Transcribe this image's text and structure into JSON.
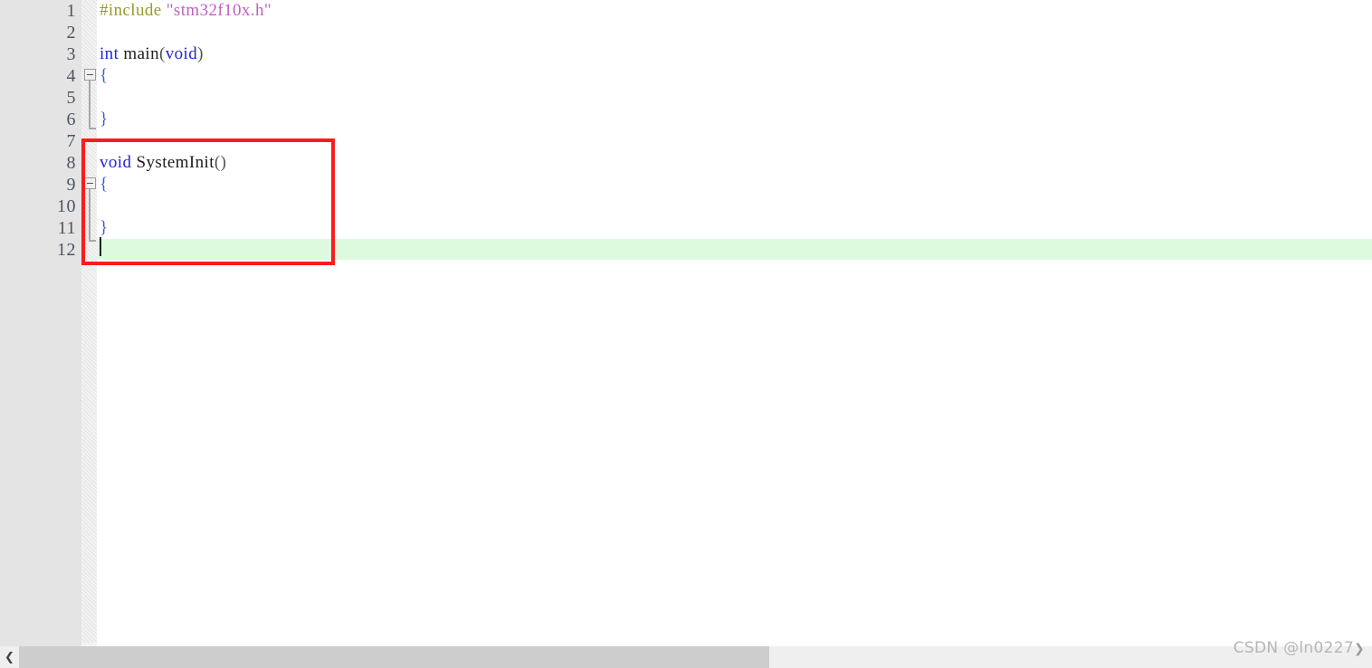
{
  "editor": {
    "language": "c",
    "line_height_px": 24,
    "colors": {
      "gutter_background": "#e4e4e4",
      "fold_strip_background": "#f3f3f3",
      "current_line_highlight": "#ddfade",
      "annotation_rectangle": "#fd1b1b",
      "preprocessor": "#9a9a24",
      "string": "#c060c0",
      "keyword": "#2424d8",
      "identifier": "#1c1c1c",
      "line_number": "#4d5663",
      "scrollbar_thumb": "#cdcdcd"
    },
    "lines": [
      {
        "number": "1",
        "tokens": [
          {
            "t": "#include ",
            "c": "tk-pre"
          },
          {
            "t": "\"stm32f10x.h\"",
            "c": "tk-str"
          }
        ]
      },
      {
        "number": "2",
        "tokens": []
      },
      {
        "number": "3",
        "tokens": [
          {
            "t": "int ",
            "c": "tk-kw"
          },
          {
            "t": "main",
            "c": "tk-id"
          },
          {
            "t": "(",
            "c": "tk-pn"
          },
          {
            "t": "void",
            "c": "tk-kw"
          },
          {
            "t": ")",
            "c": "tk-pn"
          }
        ]
      },
      {
        "number": "4",
        "tokens": [
          {
            "t": "{",
            "c": "tk-brace"
          }
        ]
      },
      {
        "number": "5",
        "tokens": []
      },
      {
        "number": "6",
        "tokens": [
          {
            "t": "}",
            "c": "tk-brace"
          }
        ]
      },
      {
        "number": "7",
        "tokens": []
      },
      {
        "number": "8",
        "tokens": [
          {
            "t": "void ",
            "c": "tk-kw"
          },
          {
            "t": "SystemInit",
            "c": "tk-id"
          },
          {
            "t": "()",
            "c": "tk-pn"
          }
        ]
      },
      {
        "number": "9",
        "tokens": [
          {
            "t": "{",
            "c": "tk-brace"
          }
        ]
      },
      {
        "number": "10",
        "tokens": []
      },
      {
        "number": "11",
        "tokens": [
          {
            "t": "}",
            "c": "tk-brace"
          }
        ]
      },
      {
        "number": "12",
        "tokens": []
      }
    ],
    "current_line": "12",
    "fold_markers": [
      {
        "line": "4",
        "state": "expanded",
        "glyph": "minus"
      },
      {
        "line": "9",
        "state": "expanded",
        "glyph": "minus"
      }
    ],
    "annotation": {
      "shape": "rectangle",
      "color": "#fd1b1b",
      "covers_lines": "7-12"
    }
  },
  "scrollbar": {
    "orientation": "horizontal",
    "left_button_glyph": "❮",
    "thumb_fraction_percent": 55
  },
  "watermark": {
    "text": "CSDN @ln0227",
    "chevron": "❯"
  }
}
